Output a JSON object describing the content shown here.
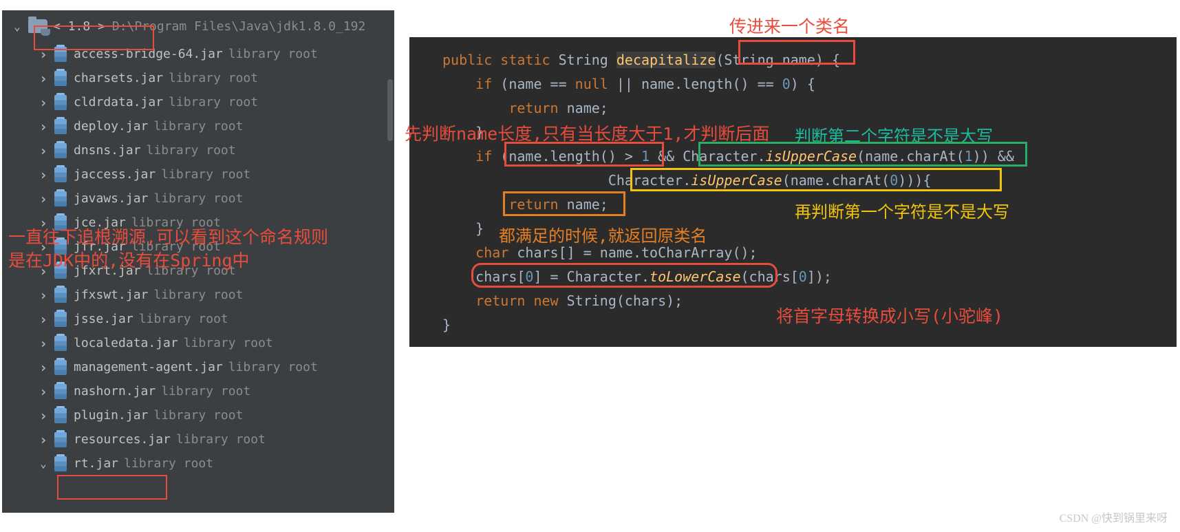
{
  "sidebar": {
    "root_label": "< 1.8 >",
    "root_path": "D:\\Program Files\\Java\\jdk1.8.0_192",
    "suffix": "library root",
    "items": [
      {
        "name": "access-bridge-64.jar",
        "expanded": false
      },
      {
        "name": "charsets.jar",
        "expanded": false
      },
      {
        "name": "cldrdata.jar",
        "expanded": false
      },
      {
        "name": "deploy.jar",
        "expanded": false
      },
      {
        "name": "dnsns.jar",
        "expanded": false
      },
      {
        "name": "jaccess.jar",
        "expanded": false
      },
      {
        "name": "javaws.jar",
        "expanded": false
      },
      {
        "name": "jce.jar",
        "expanded": false
      },
      {
        "name": "jfr.jar",
        "expanded": false
      },
      {
        "name": "jfxrt.jar",
        "expanded": false
      },
      {
        "name": "jfxswt.jar",
        "expanded": false
      },
      {
        "name": "jsse.jar",
        "expanded": false
      },
      {
        "name": "localedata.jar",
        "expanded": false
      },
      {
        "name": "management-agent.jar",
        "expanded": false
      },
      {
        "name": "nashorn.jar",
        "expanded": false
      },
      {
        "name": "plugin.jar",
        "expanded": false
      },
      {
        "name": "resources.jar",
        "expanded": false
      },
      {
        "name": "rt.jar",
        "expanded": true
      }
    ]
  },
  "code": {
    "l1a": "public",
    "l1b": " static ",
    "l1c": "String ",
    "l1d": "decapitalize",
    "l1e": "(String name) {",
    "l2a": "    if ",
    "l2b": "(name == ",
    "l2c": "null",
    "l2d": " || name.length() == ",
    "l2e": "0",
    "l2f": ") {",
    "l3a": "        return ",
    "l3b": "name;",
    "l4": "    }",
    "l5a": "    if ",
    "l5b": "(name.length() > ",
    "l5c": "1",
    "l5d": " && Character.",
    "l5e": "isUpperCase",
    "l5f": "(name.charAt(",
    "l5g": "1",
    "l5h": ")) &&",
    "l6a": "                    Character.",
    "l6b": "isUpperCase",
    "l6c": "(name.charAt(",
    "l6d": "0",
    "l6e": "))){",
    "l7a": "        return ",
    "l7b": "name;",
    "l8": "    }",
    "l9a": "    char ",
    "l9b": "chars[] = name.toCharArray();",
    "l10a": "    chars[",
    "l10b": "0",
    "l10c": "] = Character.",
    "l10d": "toLowerCase",
    "l10e": "(chars[",
    "l10f": "0",
    "l10g": "]);",
    "l11a": "    return new ",
    "l11b": "String(chars);",
    "l12": "}"
  },
  "ann": {
    "top": "传进来一个类名",
    "left1": "一直往下追根溯源,可以看到这个命名规则",
    "left2": "是在JDK中的,没有在Spring中",
    "red_len": "先判断name长度,只有当长度大于1,才判断后面",
    "green": "判断第二个字符是不是大写",
    "yellow": "再判断第一个字符是不是大写",
    "orange": "都满足的时候,就返回原类名",
    "red_lower": "将首字母转换成小写(小驼峰)"
  },
  "watermark": "CSDN @快到锅里来呀"
}
